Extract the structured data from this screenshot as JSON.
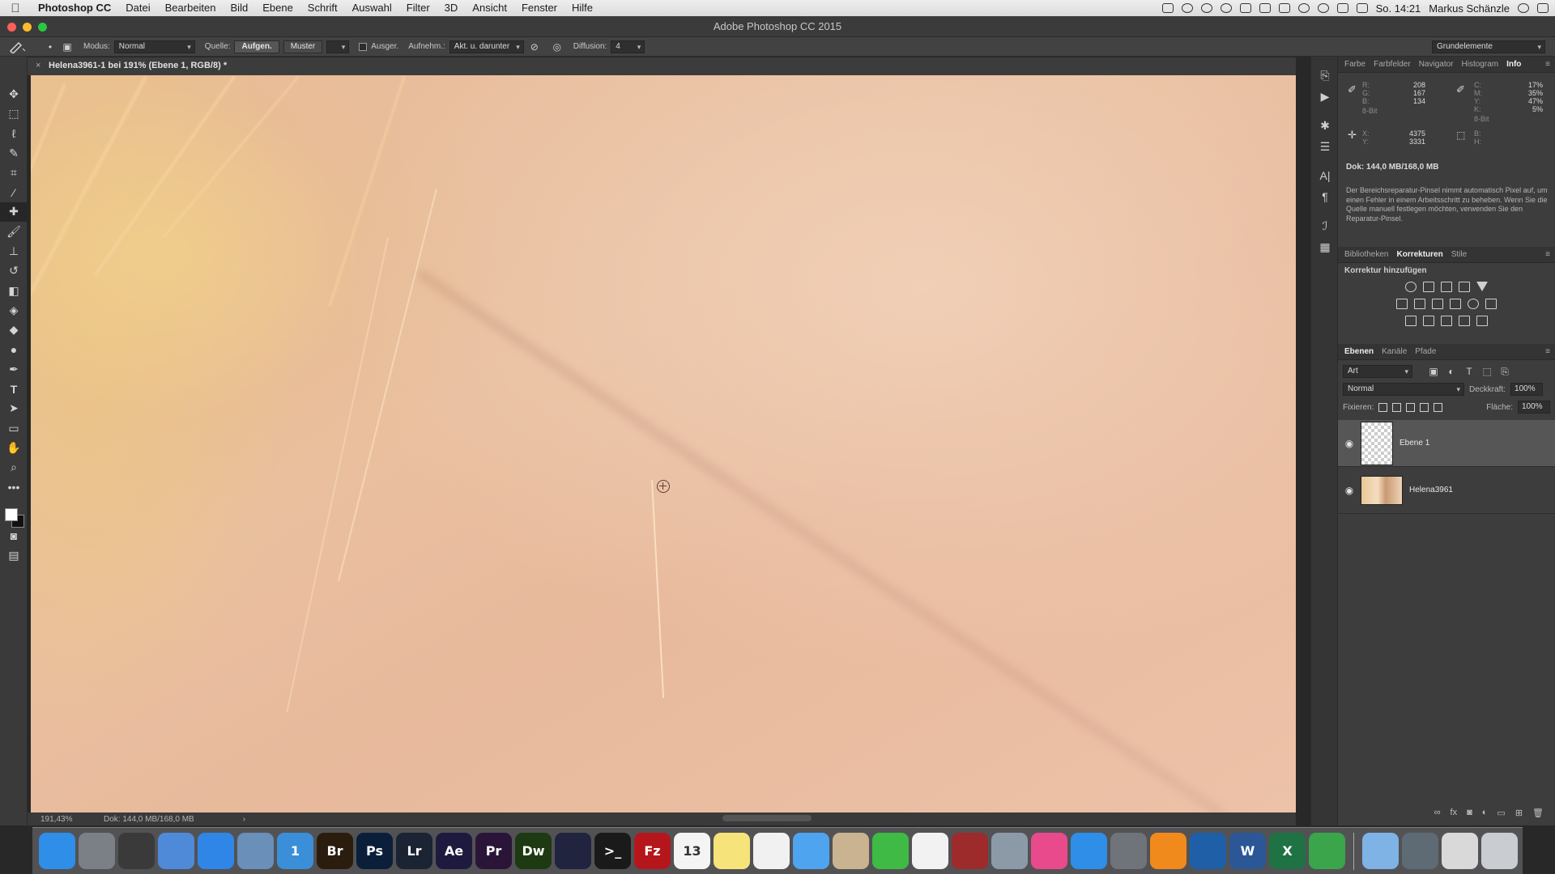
{
  "menubar": {
    "app": "Photoshop CC",
    "items": [
      "Datei",
      "Bearbeiten",
      "Bild",
      "Ebene",
      "Schrift",
      "Auswahl",
      "Filter",
      "3D",
      "Ansicht",
      "Fenster",
      "Hilfe"
    ],
    "clock": "So. 14:21",
    "user": "Markus Schänzle"
  },
  "window": {
    "title": "Adobe Photoshop CC 2015"
  },
  "options": {
    "modus_label": "Modus:",
    "modus_value": "Normal",
    "quelle_label": "Quelle:",
    "aufgen": "Aufgen.",
    "muster": "Muster",
    "ausger": "Ausger.",
    "aufnehm_label": "Aufnehm.:",
    "aufnehm_value": "Akt. u. darunter",
    "diffusion_label": "Diffusion:",
    "diffusion_value": "4",
    "workspace": "Grundelemente"
  },
  "document": {
    "tab": "Helena3961-1 bei 191% (Ebene 1, RGB/8) *",
    "zoom": "191,43%",
    "status": "Dok: 144,0 MB/168,0 MB"
  },
  "info_panel": {
    "tabs": [
      "Farbe",
      "Farbfelder",
      "Navigator",
      "Histogram",
      "Info"
    ],
    "active_tab": "Info",
    "rgb_labels": [
      "R:",
      "G:",
      "B:"
    ],
    "rgb_values": [
      "208",
      "167",
      "134"
    ],
    "cmyk_labels": [
      "C:",
      "M:",
      "Y:",
      "K:"
    ],
    "cmyk_values": [
      "17%",
      "35%",
      "47%",
      "5%"
    ],
    "bit_left": "8-Bit",
    "bit_right": "8-Bit",
    "xy_labels": [
      "X:",
      "Y:"
    ],
    "xy_values": [
      "4375",
      "3331"
    ],
    "bh_labels": [
      "B:",
      "H:"
    ],
    "doc": "Dok: 144,0 MB/168,0 MB",
    "help": "Der Bereichsreparatur-Pinsel nimmt automatisch Pixel auf, um einen Fehler in einem Arbeitsschritt zu beheben. Wenn Sie die Quelle manuell festlegen möchten, verwenden Sie den Reparatur-Pinsel."
  },
  "adjustments_panel": {
    "tabs": [
      "Bibliotheken",
      "Korrekturen",
      "Stile"
    ],
    "active_tab": "Korrekturen",
    "title": "Korrektur hinzufügen"
  },
  "layers_panel": {
    "tabs": [
      "Ebenen",
      "Kanäle",
      "Pfade"
    ],
    "active_tab": "Ebenen",
    "filter": "Art",
    "blend": "Normal",
    "opacity_label": "Deckkraft:",
    "opacity": "100%",
    "lock_label": "Fixieren:",
    "fill_label": "Fläche:",
    "fill": "100%",
    "layers": [
      {
        "name": "Ebene 1",
        "selected": true
      },
      {
        "name": "Helena3961",
        "selected": false
      }
    ]
  },
  "dock": {
    "apps": [
      {
        "icon": "finder-icon",
        "label": "",
        "color": "#2f8ee8"
      },
      {
        "icon": "launchpad-icon",
        "label": "",
        "color": "#7b7f86"
      },
      {
        "icon": "mission-control-icon",
        "label": "",
        "color": "#3a3a3a"
      },
      {
        "icon": "preview-icon",
        "label": "",
        "color": "#4f8ad9"
      },
      {
        "icon": "safari-icon",
        "label": "",
        "color": "#2f86e6"
      },
      {
        "icon": "mail-icon",
        "label": "",
        "color": "#6a8fb8"
      },
      {
        "icon": "1password-icon",
        "label": "1",
        "color": "#3b8fd8"
      },
      {
        "icon": "bridge-icon",
        "label": "Br",
        "color": "#2b1d0e"
      },
      {
        "icon": "photoshop-icon",
        "label": "Ps",
        "color": "#0b1f3a"
      },
      {
        "icon": "lightroom-icon",
        "label": "Lr",
        "color": "#1b2433"
      },
      {
        "icon": "after-effects-icon",
        "label": "Ae",
        "color": "#1e1a3f"
      },
      {
        "icon": "premiere-icon",
        "label": "Pr",
        "color": "#2a1538"
      },
      {
        "icon": "dreamweaver-icon",
        "label": "Dw",
        "color": "#1d3a12"
      },
      {
        "icon": "media-encoder-icon",
        "label": "",
        "color": "#21243f"
      },
      {
        "icon": "terminal-icon",
        "label": ">_",
        "color": "#1a1a1a"
      },
      {
        "icon": "filezilla-icon",
        "label": "Fz",
        "color": "#b5161b"
      },
      {
        "icon": "calendar-icon",
        "label": "13",
        "color": "#f4f4f4"
      },
      {
        "icon": "notes-icon",
        "label": "",
        "color": "#f6e47a"
      },
      {
        "icon": "reminders-icon",
        "label": "",
        "color": "#f1f1f1"
      },
      {
        "icon": "messages-icon",
        "label": "",
        "color": "#4fa4f0"
      },
      {
        "icon": "contacts-icon",
        "label": "",
        "color": "#c9b391"
      },
      {
        "icon": "facetime-icon",
        "label": "",
        "color": "#3fba45"
      },
      {
        "icon": "photos-icon",
        "label": "",
        "color": "#f2f2f2"
      },
      {
        "icon": "photo-booth-icon",
        "label": "",
        "color": "#9d2b2b"
      },
      {
        "icon": "image-capture-icon",
        "label": "",
        "color": "#8c9aa8"
      },
      {
        "icon": "itunes-icon",
        "label": "",
        "color": "#e94a8c"
      },
      {
        "icon": "app-store-icon",
        "label": "",
        "color": "#2f8ee8"
      },
      {
        "icon": "system-preferences-icon",
        "label": "",
        "color": "#6f737a"
      },
      {
        "icon": "vlc-icon",
        "label": "",
        "color": "#f08a1c"
      },
      {
        "icon": "quicktime-icon",
        "label": "",
        "color": "#1e5fa8"
      },
      {
        "icon": "word-icon",
        "label": "W",
        "color": "#2b5797"
      },
      {
        "icon": "excel-icon",
        "label": "X",
        "color": "#1f7244"
      },
      {
        "icon": "evernote-icon",
        "label": "",
        "color": "#3aa54a"
      },
      {
        "icon": "applications-folder-icon",
        "label": "",
        "color": "#7fb2e5"
      },
      {
        "icon": "brushes-icon",
        "label": "",
        "color": "#5e6a74"
      },
      {
        "icon": "documents-stack-icon",
        "label": "",
        "color": "#d9d9d9"
      },
      {
        "icon": "trash-icon",
        "label": "",
        "color": "#c9ccd1"
      }
    ]
  }
}
